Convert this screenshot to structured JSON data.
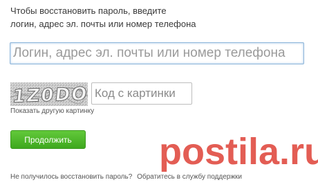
{
  "instructions": {
    "line1": "Чтобы восстановить пароль, введите",
    "line2": "логин, адрес эл. почты или номер телефона"
  },
  "login_field": {
    "placeholder": "Логин, адрес эл. почты или номер телефона",
    "value": ""
  },
  "captcha": {
    "image_text": "1Z0DO",
    "input_placeholder": "Код с картинки",
    "input_value": "",
    "refresh_label": "Показать другую картинку"
  },
  "continue_button": {
    "label": "Продолжить"
  },
  "footer": {
    "question": "Не получилось восстановить пароль?",
    "support_link": "Обратитесь в службу поддержки"
  },
  "watermark": {
    "text": "postila.ru"
  },
  "colors": {
    "button_green": "#4cb52a",
    "input_focus_border": "#8fb6da",
    "watermark_red": "#e0473d"
  }
}
